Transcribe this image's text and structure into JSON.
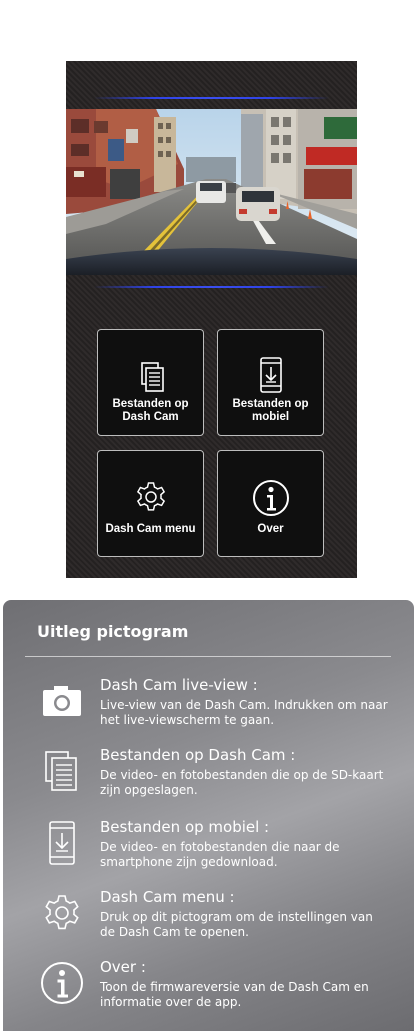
{
  "buttons": [
    {
      "label": "Bestanden op\nDash Cam",
      "icon": "files-icon"
    },
    {
      "label": "Bestanden op\nmobiel",
      "icon": "phone-download-icon"
    },
    {
      "label": "Dash Cam menu",
      "icon": "gear-icon"
    },
    {
      "label": "Over",
      "icon": "info-icon"
    }
  ],
  "legend": {
    "title": "Uitleg pictogram",
    "items": [
      {
        "icon": "camera-icon",
        "heading": "Dash Cam live-view :",
        "text": "Live-view van de Dash Cam. Indrukken om naar het live-viewscherm te gaan."
      },
      {
        "icon": "files-icon",
        "heading": "Bestanden op Dash Cam :",
        "text": "De video- en fotobestanden die op de SD-kaart zijn opgeslagen."
      },
      {
        "icon": "phone-download-icon",
        "heading": "Bestanden op mobiel :",
        "text": "De video- en fotobestanden die naar de smartphone zijn gedownload."
      },
      {
        "icon": "gear-icon",
        "heading": "Dash Cam menu :",
        "text": "Druk op dit pictogram om de instellingen van de Dash Cam te openen."
      },
      {
        "icon": "info-icon",
        "heading": "Over :",
        "text": "Toon de firmwareversie van de Dash Cam en informatie over de app."
      }
    ]
  },
  "colors": {
    "accent_line": "#3b4ff0",
    "legend_bg": "#8a8a8e",
    "phone_bg": "#2a2626"
  }
}
